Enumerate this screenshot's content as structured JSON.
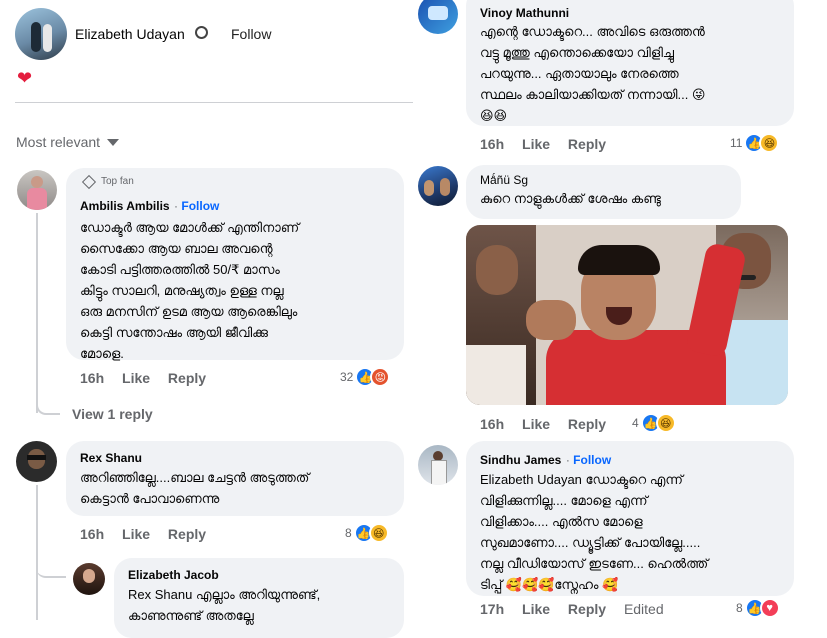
{
  "post": {
    "author": "Elizabeth Udayan",
    "follow_label": "Follow",
    "heart": "❤",
    "sort_label": "Most relevant"
  },
  "left_comments": [
    {
      "badge": "Top fan",
      "name": "Ambilis Ambilis",
      "follow": "Follow",
      "lines": [
        "ഡോക്ടർ ആയ മോൾക്ക് എന്തിനാണ്",
        "സൈക്കോ ആയ ബാല അവന്റെ",
        "കോടി പട്ടിത്തരത്തിൽ 50/₹ മാസം",
        "കിട്ടും സാലറി, മനുഷ്യത്വം ഉള്ള നല്ല",
        "ഒരു മനസിന് ഉടമ ആയ ആരെങ്കിലും",
        "കെട്ടി സന്തോഷം ആയി ജീവിക്കു",
        "മോളെ."
      ],
      "time": "16h",
      "like": "Like",
      "reply": "Reply",
      "reaction_count": "32",
      "view_reply": "View 1 reply"
    },
    {
      "name": "Rex Shanu",
      "lines": [
        "അറിഞ്ഞില്ലേ....ബാല ചേട്ടൻ അടുത്തത്",
        "കെട്ടാൻ പോവാണെന്നു"
      ],
      "time": "16h",
      "like": "Like",
      "reply": "Reply",
      "reaction_count": "8"
    },
    {
      "name": "Elizabeth Jacob",
      "lines": [
        "Rex Shanu എല്ലാം അറിയുന്നുണ്ട്,",
        "കാണുന്നുണ്ട് അതല്ലേ"
      ]
    }
  ],
  "right_comments": [
    {
      "name": "Vinoy Mathunni",
      "lines": [
        "എന്റെ ഡോക്ടറെ... അവിടെ ഒരുത്തൻ",
        "വട്ടു മൂത്തു എന്തൊക്കെയോ വിളിച്ചു",
        "പറയുന്നു... ഏതായാലും നേരത്തെ",
        "സ്ഥലം കാലിയാക്കിയത് നന്നായി... 😜",
        "😆😆"
      ],
      "time": "16h",
      "like": "Like",
      "reply": "Reply",
      "reaction_count": "11"
    },
    {
      "name": "Mǻñü Sg",
      "lines": [
        "കുറെ നാളുകൾക്ക് ശേഷം കണ്ടു"
      ],
      "time": "16h",
      "like": "Like",
      "reply": "Reply",
      "reaction_count": "4"
    },
    {
      "name": "Sindhu James",
      "follow": "Follow",
      "lines": [
        "Elizabeth Udayan ഡോക്ടറെ എന്ന്",
        "വിളിക്കുന്നില്ല.... മോളെ എന്ന്",
        "വിളിക്കാം.... എൽസ മോളെ",
        "സുഖമാണോ.... ഡ്യൂട്ടിക്ക് പോയില്ലേ.....",
        "നല്ല വീഡിയോസ് ഇടണേ... ഹെൽത്ത്",
        "ടിപ്പ് 🥰🥰🥰സ്നേഹം 🥰"
      ],
      "time": "17h",
      "like": "Like",
      "reply": "Reply",
      "edited": "Edited",
      "reaction_count": "8"
    }
  ],
  "colors": {
    "accent": "#0866ff",
    "bubble": "#f0f2f5",
    "muted": "#65676b"
  }
}
